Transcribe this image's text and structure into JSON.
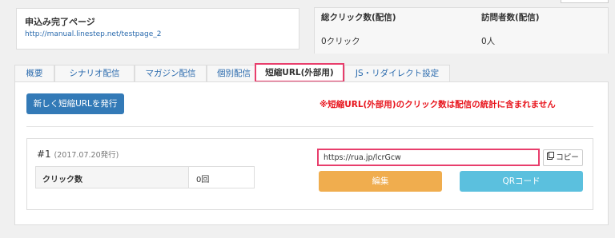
{
  "page_info": {
    "title": "申込み完了ページ",
    "url": "http://manual.linestep.net/testpage_2"
  },
  "stats": {
    "headers": [
      "総クリック数(配信)",
      "訪問者数(配信)"
    ],
    "values": [
      "0クリック",
      "0人"
    ]
  },
  "tabs": [
    {
      "label": "概要"
    },
    {
      "label": "シナリオ配信"
    },
    {
      "label": "マガジン配信"
    },
    {
      "label": "個別配信"
    },
    {
      "label": "短縮URL(外部用)"
    },
    {
      "label": "JS・リダイレクト設定"
    }
  ],
  "active_tab_index": 4,
  "panel": {
    "new_button_label": "新しく短縮URLを発行",
    "notice": "※短縮URL(外部用)のクリック数は配信の統計に含まれません"
  },
  "entry": {
    "number": "#1",
    "date": "(2017.07.20発行)",
    "click_label": "クリック数",
    "click_value": "0回",
    "short_url": "https://rua.jp/lcrGcw",
    "copy_label": "コピー",
    "copy_icon": "clipboard-icon",
    "edit_label": "編集",
    "qr_label": "QRコード"
  },
  "colors": {
    "primary": "#337ab7",
    "warning": "#f0ad4e",
    "info": "#5bc0de",
    "highlight": "#e83e6c",
    "notice": "#e8141c",
    "link": "#2a6aad"
  }
}
